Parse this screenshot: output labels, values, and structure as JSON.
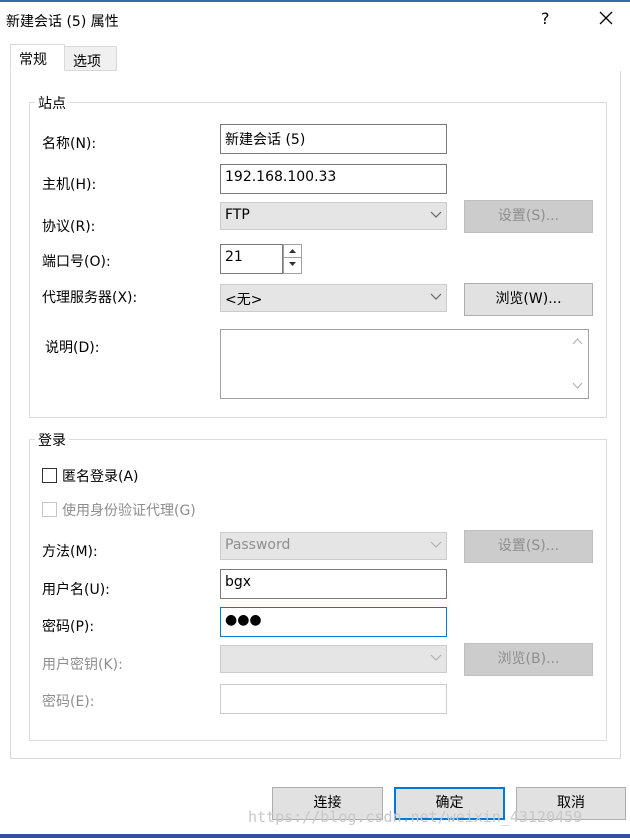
{
  "window": {
    "title": "新建会话 (5) 属性",
    "help": "?"
  },
  "tabs": [
    {
      "label": "常规"
    },
    {
      "label": "选项"
    }
  ],
  "site": {
    "group_label": "站点",
    "name_label": "名称(N):",
    "name_value": "新建会话 (5)",
    "host_label": "主机(H):",
    "host_value": "192.168.100.33",
    "protocol_label": "协议(R):",
    "protocol_value": "FTP",
    "protocol_settings": "设置(S)...",
    "port_label": "端口号(O):",
    "port_value": "21",
    "proxy_label": "代理服务器(X):",
    "proxy_value": "<无>",
    "proxy_browse": "浏览(W)...",
    "desc_label": "说明(D):",
    "desc_value": ""
  },
  "login": {
    "group_label": "登录",
    "anonymous_label": "匿名登录(A)",
    "anonymous_checked": false,
    "auth_proxy_label": "使用身份验证代理(G)",
    "method_label": "方法(M):",
    "method_value": "Password",
    "method_settings": "设置(S)...",
    "username_label": "用户名(U):",
    "username_value": "bgx",
    "password_label": "密码(P):",
    "password_value": "●●●",
    "userkey_label": "用户密钥(K):",
    "userkey_value": "",
    "userkey_browse": "浏览(B)...",
    "passphrase_label": "密码(E):",
    "passphrase_value": ""
  },
  "footer": {
    "connect": "连接",
    "ok": "确定",
    "cancel": "取消"
  },
  "watermark": "https://blog.csdn.net/weixin_43120459",
  "colors": {
    "accent": "#0078d7",
    "title_bar_line": "#2b6cb0"
  }
}
